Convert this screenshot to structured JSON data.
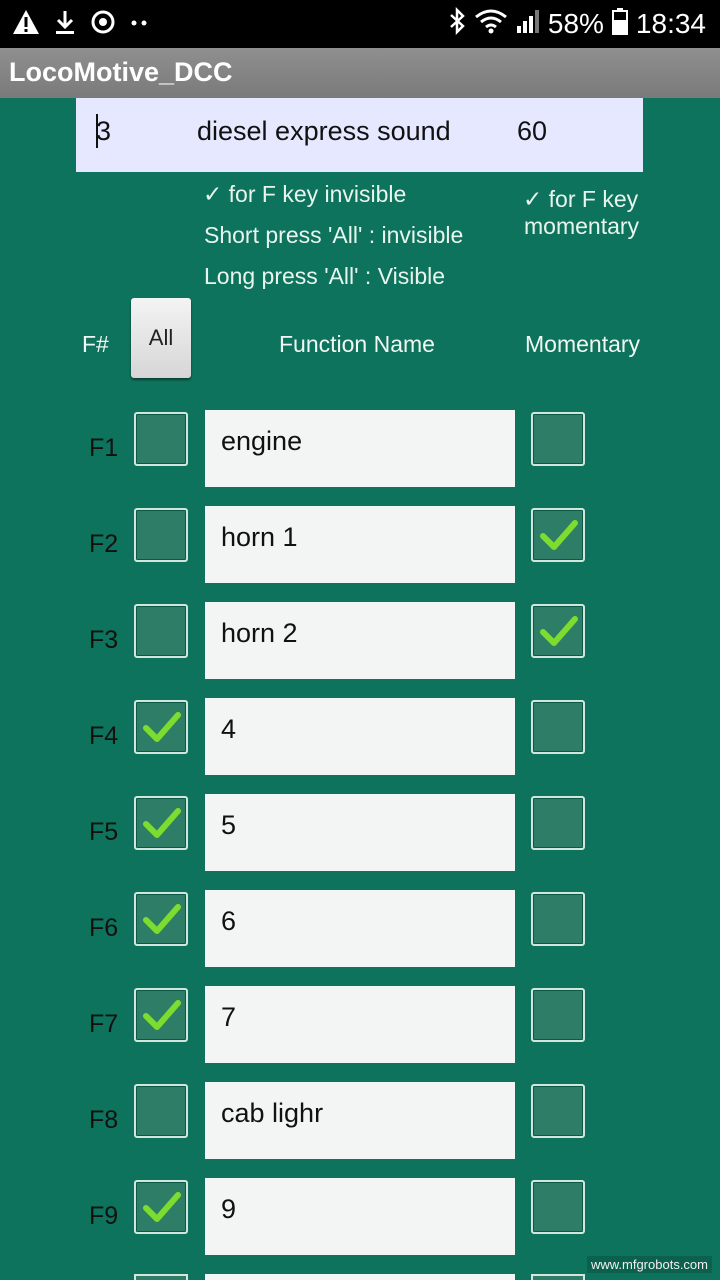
{
  "status_bar": {
    "battery_percent": "58%",
    "time": "18:34"
  },
  "app": {
    "title": "LocoMotive_DCC"
  },
  "loco": {
    "address": "3",
    "name": "diesel express sound",
    "speed": "60"
  },
  "hints": {
    "invisible": "✓ for F key invisible",
    "short_press": "Short press 'All' : invisible",
    "long_press": "Long press 'All' : Visible",
    "momentary_line1": "✓ for F key",
    "momentary_line2": "momentary"
  },
  "headers": {
    "fnum": "F#",
    "all_button": "All",
    "function_name": "Function Name",
    "momentary": "Momentary"
  },
  "functions": [
    {
      "key": "F1",
      "name": "engine",
      "invisible": false,
      "momentary": false
    },
    {
      "key": "F2",
      "name": "horn 1",
      "invisible": false,
      "momentary": true
    },
    {
      "key": "F3",
      "name": "horn 2",
      "invisible": false,
      "momentary": true
    },
    {
      "key": "F4",
      "name": "4",
      "invisible": true,
      "momentary": false
    },
    {
      "key": "F5",
      "name": "5",
      "invisible": true,
      "momentary": false
    },
    {
      "key": "F6",
      "name": "6",
      "invisible": true,
      "momentary": false
    },
    {
      "key": "F7",
      "name": "7",
      "invisible": true,
      "momentary": false
    },
    {
      "key": "F8",
      "name": "cab lighr",
      "invisible": false,
      "momentary": false
    },
    {
      "key": "F9",
      "name": "9",
      "invisible": true,
      "momentary": false
    }
  ],
  "colors": {
    "background": "#0e735c",
    "check": "#7ddc2e",
    "input_bg": "#f2f5f4",
    "loco_bg": "#e6e8ff"
  },
  "watermark": "www.mfgrobots.com"
}
